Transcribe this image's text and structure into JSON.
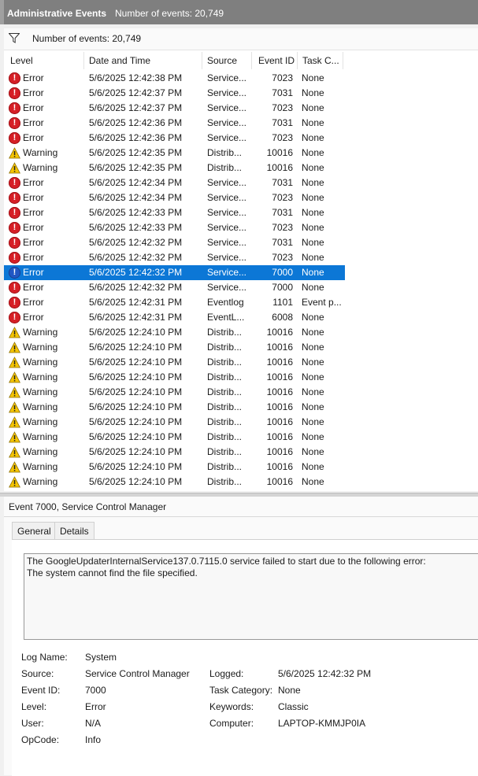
{
  "header": {
    "title": "Administrative Events",
    "event_count": "Number of events: 20,749"
  },
  "filterbar": {
    "icon": "filter-icon",
    "text": "Number of events: 20,749"
  },
  "columns": [
    "Level",
    "Date and Time",
    "Source",
    "Event ID",
    "Task C..."
  ],
  "rows": [
    {
      "level": "Error",
      "date": "5/6/2025 12:42:38 PM",
      "source": "Service...",
      "id": "7023",
      "task": "None"
    },
    {
      "level": "Error",
      "date": "5/6/2025 12:42:37 PM",
      "source": "Service...",
      "id": "7031",
      "task": "None"
    },
    {
      "level": "Error",
      "date": "5/6/2025 12:42:37 PM",
      "source": "Service...",
      "id": "7023",
      "task": "None"
    },
    {
      "level": "Error",
      "date": "5/6/2025 12:42:36 PM",
      "source": "Service...",
      "id": "7031",
      "task": "None"
    },
    {
      "level": "Error",
      "date": "5/6/2025 12:42:36 PM",
      "source": "Service...",
      "id": "7023",
      "task": "None"
    },
    {
      "level": "Warning",
      "date": "5/6/2025 12:42:35 PM",
      "source": "Distrib...",
      "id": "10016",
      "task": "None"
    },
    {
      "level": "Warning",
      "date": "5/6/2025 12:42:35 PM",
      "source": "Distrib...",
      "id": "10016",
      "task": "None"
    },
    {
      "level": "Error",
      "date": "5/6/2025 12:42:34 PM",
      "source": "Service...",
      "id": "7031",
      "task": "None"
    },
    {
      "level": "Error",
      "date": "5/6/2025 12:42:34 PM",
      "source": "Service...",
      "id": "7023",
      "task": "None"
    },
    {
      "level": "Error",
      "date": "5/6/2025 12:42:33 PM",
      "source": "Service...",
      "id": "7031",
      "task": "None"
    },
    {
      "level": "Error",
      "date": "5/6/2025 12:42:33 PM",
      "source": "Service...",
      "id": "7023",
      "task": "None"
    },
    {
      "level": "Error",
      "date": "5/6/2025 12:42:32 PM",
      "source": "Service...",
      "id": "7031",
      "task": "None"
    },
    {
      "level": "Error",
      "date": "5/6/2025 12:42:32 PM",
      "source": "Service...",
      "id": "7023",
      "task": "None"
    },
    {
      "level": "Error",
      "date": "5/6/2025 12:42:32 PM",
      "source": "Service...",
      "id": "7000",
      "task": "None",
      "selected": true
    },
    {
      "level": "Error",
      "date": "5/6/2025 12:42:32 PM",
      "source": "Service...",
      "id": "7000",
      "task": "None"
    },
    {
      "level": "Error",
      "date": "5/6/2025 12:42:31 PM",
      "source": "Eventlog",
      "id": "1101",
      "task": "Event p..."
    },
    {
      "level": "Error",
      "date": "5/6/2025 12:42:31 PM",
      "source": "EventL...",
      "id": "6008",
      "task": "None"
    },
    {
      "level": "Warning",
      "date": "5/6/2025 12:24:10 PM",
      "source": "Distrib...",
      "id": "10016",
      "task": "None"
    },
    {
      "level": "Warning",
      "date": "5/6/2025 12:24:10 PM",
      "source": "Distrib...",
      "id": "10016",
      "task": "None"
    },
    {
      "level": "Warning",
      "date": "5/6/2025 12:24:10 PM",
      "source": "Distrib...",
      "id": "10016",
      "task": "None"
    },
    {
      "level": "Warning",
      "date": "5/6/2025 12:24:10 PM",
      "source": "Distrib...",
      "id": "10016",
      "task": "None"
    },
    {
      "level": "Warning",
      "date": "5/6/2025 12:24:10 PM",
      "source": "Distrib...",
      "id": "10016",
      "task": "None"
    },
    {
      "level": "Warning",
      "date": "5/6/2025 12:24:10 PM",
      "source": "Distrib...",
      "id": "10016",
      "task": "None"
    },
    {
      "level": "Warning",
      "date": "5/6/2025 12:24:10 PM",
      "source": "Distrib...",
      "id": "10016",
      "task": "None"
    },
    {
      "level": "Warning",
      "date": "5/6/2025 12:24:10 PM",
      "source": "Distrib...",
      "id": "10016",
      "task": "None"
    },
    {
      "level": "Warning",
      "date": "5/6/2025 12:24:10 PM",
      "source": "Distrib...",
      "id": "10016",
      "task": "None"
    },
    {
      "level": "Warning",
      "date": "5/6/2025 12:24:10 PM",
      "source": "Distrib...",
      "id": "10016",
      "task": "None"
    },
    {
      "level": "Warning",
      "date": "5/6/2025 12:24:10 PM",
      "source": "Distrib...",
      "id": "10016",
      "task": "None"
    }
  ],
  "detail": {
    "title": "Event 7000, Service Control Manager",
    "tabs": [
      "General",
      "Details"
    ],
    "message_line1": "The GoogleUpdaterInternalService137.0.7115.0 service failed to start due to the following error:",
    "message_line2": "The system cannot find the file specified.",
    "props_left": [
      {
        "label": "Log Name:",
        "value": "System"
      },
      {
        "label": "Source:",
        "value": "Service Control Manager"
      },
      {
        "label": "Event ID:",
        "value": "7000"
      },
      {
        "label": "Level:",
        "value": "Error"
      },
      {
        "label": "User:",
        "value": "N/A"
      },
      {
        "label": "OpCode:",
        "value": "Info"
      }
    ],
    "props_right": [
      {
        "label": "Logged:",
        "value": "5/6/2025 12:42:32 PM"
      },
      {
        "label": "Task Category:",
        "value": "None"
      },
      {
        "label": "Keywords:",
        "value": "Classic"
      },
      {
        "label": "Computer:",
        "value": "LAPTOP-KMMJP0IA"
      }
    ]
  },
  "colors": {
    "error": "#d61f26",
    "warning": "#f5c400",
    "selection": "#0c77d6",
    "titlebar": "#7f7f7f"
  }
}
